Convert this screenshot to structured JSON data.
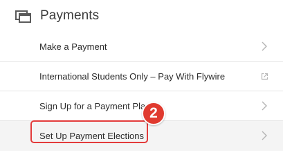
{
  "header": {
    "icon": "windows-stack-icon",
    "title": "Payments"
  },
  "menu": {
    "items": [
      {
        "label": "Make a Payment",
        "trailing_icon": "chevron-right-icon"
      },
      {
        "label": "International Students Only – Pay With Flywire",
        "trailing_icon": "external-link-icon"
      },
      {
        "label": "Sign Up for a Payment Plan",
        "trailing_icon": "chevron-right-icon"
      },
      {
        "label": "Set Up Payment Elections",
        "trailing_icon": "chevron-right-icon"
      }
    ]
  },
  "annotation": {
    "step_number": "2",
    "color": "#e03a2f"
  }
}
